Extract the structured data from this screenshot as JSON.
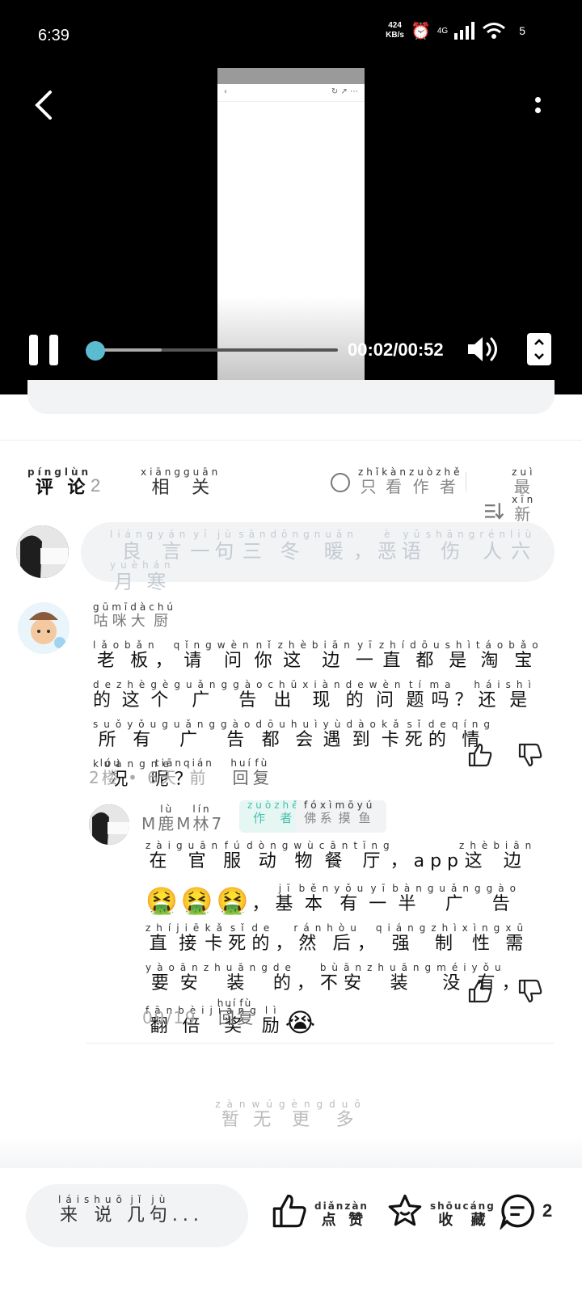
{
  "status_bar": {
    "time": "6:39",
    "net_speed_value": "424",
    "net_speed_unit": "KB/s",
    "network": "4G",
    "battery": "5"
  },
  "video": {
    "time": "00:02/00:52",
    "progress": 0.04,
    "buffered": 0.3
  },
  "tabs": {
    "comment": {
      "chars": [
        "评",
        "论"
      ],
      "pinyin": [
        "píng",
        "lùn"
      ]
    },
    "comment_count": "2",
    "related": {
      "chars": [
        "相",
        "关"
      ],
      "pinyin": [
        "xiāng",
        "guān"
      ]
    },
    "only_author": {
      "chars": [
        "只",
        "看",
        "作",
        "者"
      ],
      "pinyin": [
        "zhǐ",
        "kàn",
        "zuò",
        "zhě"
      ]
    },
    "newest": {
      "chars": [
        "最",
        "新"
      ],
      "pinyin": [
        "zuì",
        "xīn"
      ]
    }
  },
  "input_placeholder": {
    "chars": [
      "良",
      "言",
      "一",
      "句",
      "三",
      "冬",
      "暖",
      "，",
      "恶",
      "语",
      "伤",
      "人",
      "六",
      "月",
      "寒"
    ],
    "pinyin": [
      "liáng",
      "yán",
      "yī",
      "jù",
      "sān",
      "dōng",
      "nuǎn",
      "",
      "è",
      "yǔ",
      "shāng",
      "rén",
      "liù",
      "yuè",
      "hán"
    ]
  },
  "comments": [
    {
      "user": {
        "chars": [
          "咕",
          "咪",
          "大",
          "厨"
        ],
        "pinyin": [
          "gū",
          "mī",
          "dà",
          "chú"
        ]
      },
      "body": {
        "chars": [
          "老",
          "板",
          "，",
          "请",
          "问",
          "你",
          "这",
          "边",
          "一",
          "直",
          "都",
          "是",
          "淘",
          "宝",
          "的",
          "这",
          "个",
          "广",
          "告",
          "出",
          "现",
          "的",
          "问",
          "题",
          "吗",
          "？",
          "还",
          "是",
          "所",
          "有",
          "广",
          "告",
          "都",
          "会",
          "遇",
          "到",
          "卡",
          "死",
          "的",
          "情",
          "况",
          "呢",
          "？"
        ],
        "pinyin": [
          "lǎo",
          "bǎn",
          "",
          "qǐng",
          "wèn",
          "nǐ",
          "zhè",
          "biān",
          "yī",
          "zhí",
          "dōu",
          "shì",
          "táo",
          "bǎo",
          "de",
          "zhè",
          "gè",
          "guǎng",
          "gào",
          "chū",
          "xiàn",
          "de",
          "wèn",
          "tí",
          "ma",
          "",
          "hái",
          "shì",
          "suǒ",
          "yǒu",
          "guǎng",
          "gào",
          "dōu",
          "huì",
          "yù",
          "dào",
          "kǎ",
          "sǐ",
          "de",
          "qíng",
          "kuàng",
          "ne",
          ""
        ]
      },
      "floor": "2",
      "floor_word": {
        "chars": [
          "楼"
        ],
        "pinyin": [
          "lóu"
        ]
      },
      "days": "6",
      "days_word": {
        "chars": [
          "天",
          "前"
        ],
        "pinyin": [
          "tiān",
          "qián"
        ]
      },
      "reply": {
        "chars": [
          "回",
          "复"
        ],
        "pinyin": [
          "huí",
          "fù"
        ]
      }
    }
  ],
  "reply": {
    "user_segments": [
      {
        "text": "M",
        "pinyin": ""
      },
      {
        "text": "鹿",
        "pinyin": "lù"
      },
      {
        "text": "M",
        "pinyin": ""
      },
      {
        "text": "林",
        "pinyin": "lín"
      },
      {
        "text": "7",
        "pinyin": ""
      }
    ],
    "author_badge": {
      "chars": [
        "作",
        "者"
      ],
      "pinyin": [
        "zuò",
        "zhě"
      ]
    },
    "status_badge": {
      "chars": [
        "佛",
        "系",
        "摸",
        "鱼"
      ],
      "pinyin": [
        "fó",
        "xì",
        "mō",
        "yú"
      ]
    },
    "body_segments": [
      {
        "text": "在",
        "pinyin": "zài"
      },
      {
        "text": "官",
        "pinyin": "guān"
      },
      {
        "text": "服",
        "pinyin": "fú"
      },
      {
        "text": "动",
        "pinyin": "dòng"
      },
      {
        "text": "物",
        "pinyin": "wù"
      },
      {
        "text": "餐",
        "pinyin": "cān"
      },
      {
        "text": "厅",
        "pinyin": "tīng"
      },
      {
        "text": "，",
        "pinyin": ""
      },
      {
        "text": "app",
        "pinyin": ""
      },
      {
        "text": "这",
        "pinyin": "zhè"
      },
      {
        "text": "边",
        "pinyin": "biān"
      },
      {
        "text": "🤮🤮🤮",
        "pinyin": "",
        "emoji": true
      },
      {
        "text": "，",
        "pinyin": ""
      },
      {
        "text": "基",
        "pinyin": "jī"
      },
      {
        "text": "本",
        "pinyin": "běn"
      },
      {
        "text": "有",
        "pinyin": "yǒu"
      },
      {
        "text": "一",
        "pinyin": "yī"
      },
      {
        "text": "半",
        "pinyin": "bàn"
      },
      {
        "text": "广",
        "pinyin": "guǎng"
      },
      {
        "text": "告",
        "pinyin": "gào"
      },
      {
        "text": "直",
        "pinyin": "zhí"
      },
      {
        "text": "接",
        "pinyin": "jiē"
      },
      {
        "text": "卡",
        "pinyin": "kǎ"
      },
      {
        "text": "死",
        "pinyin": "sǐ"
      },
      {
        "text": "的",
        "pinyin": "de"
      },
      {
        "text": "，",
        "pinyin": ""
      },
      {
        "text": "然",
        "pinyin": "rán"
      },
      {
        "text": "后",
        "pinyin": "hòu"
      },
      {
        "text": "，",
        "pinyin": ""
      },
      {
        "text": "强",
        "pinyin": "qiáng"
      },
      {
        "text": "制",
        "pinyin": "zhì"
      },
      {
        "text": "性",
        "pinyin": "xìng"
      },
      {
        "text": "需",
        "pinyin": "xū"
      },
      {
        "text": "要",
        "pinyin": "yào"
      },
      {
        "text": "安",
        "pinyin": "ān"
      },
      {
        "text": "装",
        "pinyin": "zhuāng"
      },
      {
        "text": "的",
        "pinyin": "de"
      },
      {
        "text": "，",
        "pinyin": ""
      },
      {
        "text": "不",
        "pinyin": "bù"
      },
      {
        "text": "安",
        "pinyin": "ān"
      },
      {
        "text": "装",
        "pinyin": "zhuāng"
      },
      {
        "text": "没",
        "pinyin": "méi"
      },
      {
        "text": "有",
        "pinyin": "yǒu"
      },
      {
        "text": "，",
        "pinyin": ""
      },
      {
        "text": "翻",
        "pinyin": "fān"
      },
      {
        "text": "倍",
        "pinyin": "bèi"
      },
      {
        "text": "奖",
        "pinyin": "jiǎng"
      },
      {
        "text": "励",
        "pinyin": "lì"
      },
      {
        "text": "😭",
        "pinyin": "",
        "emoji": true
      }
    ],
    "date": "09/19",
    "reply_action": {
      "chars": [
        "回",
        "复"
      ],
      "pinyin": [
        "huí",
        "fù"
      ]
    }
  },
  "no_more": {
    "chars": [
      "暂",
      "无",
      "更",
      "多"
    ],
    "pinyin": [
      "zàn",
      "wú",
      "gèng",
      "duō"
    ]
  },
  "bottom_bar": {
    "input": {
      "chars": [
        "来",
        "说",
        "几",
        "句"
      ],
      "pinyin": [
        "lái",
        "shuō",
        "jǐ",
        "jù"
      ],
      "suffix": "..."
    },
    "like": {
      "chars": [
        "点",
        "赞"
      ],
      "pinyin": [
        "diǎn",
        "zàn"
      ]
    },
    "favorite": {
      "chars": [
        "收",
        "藏"
      ],
      "pinyin": [
        "shōu",
        "cáng"
      ]
    },
    "comment_count": "2"
  },
  "colors": {
    "accent": "#7fd6cb",
    "progress_thumb": "#5bbcd0",
    "author_badge_text": "#49bfae"
  },
  "icons": [
    "back-icon",
    "more-icon",
    "pause-icon",
    "volume-icon",
    "fullscreen-icon",
    "circle-icon",
    "sort-icon",
    "thumbs-up-icon",
    "thumbs-down-icon",
    "star-icon",
    "comment-bubble-icon"
  ]
}
